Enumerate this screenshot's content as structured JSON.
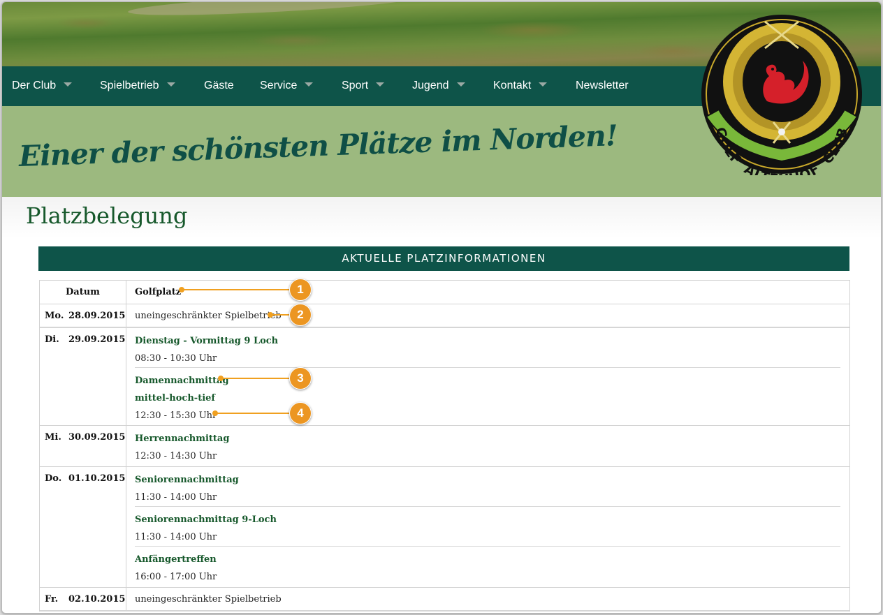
{
  "nav": {
    "items": [
      {
        "label": "Der Club",
        "dropdown": true
      },
      {
        "label": "Spielbetrieb",
        "dropdown": true
      },
      {
        "label": "Gäste",
        "dropdown": false
      },
      {
        "label": "Service",
        "dropdown": true
      },
      {
        "label": "Sport",
        "dropdown": true
      },
      {
        "label": "Jugend",
        "dropdown": true
      },
      {
        "label": "Kontakt",
        "dropdown": true
      },
      {
        "label": "Newsletter",
        "dropdown": false
      }
    ]
  },
  "banner": {
    "slogan": "Einer der schönsten Plätze im Norden!"
  },
  "logo": {
    "top_text": "GOLF",
    "ring_text": "ALTENHOF",
    "side_text": "CLUB",
    "icon": "squirrel-crest-icon"
  },
  "page": {
    "title": "Platzbelegung"
  },
  "table": {
    "header": "AKTUELLE PLATZINFORMATIONEN",
    "col_date": "Datum",
    "col_course": "Golfplatz",
    "rows": [
      {
        "dow": "Mo.",
        "date": "28.09.2015",
        "text": "uneingeschränkter Spielbetrieb"
      },
      {
        "dow": "Di.",
        "date": "29.09.2015",
        "events": [
          {
            "title": "Dienstag - Vormittag 9 Loch",
            "time": "08:30 - 10:30 Uhr"
          },
          {
            "title": "Damennachmittag",
            "subtitle": "mittel-hoch-tief",
            "time": "12:30 - 15:30 Uhr"
          }
        ]
      },
      {
        "dow": "Mi.",
        "date": "30.09.2015",
        "events": [
          {
            "title": "Herrennachmittag",
            "time": "12:30 - 14:30 Uhr"
          }
        ]
      },
      {
        "dow": "Do.",
        "date": "01.10.2015",
        "events": [
          {
            "title": "Seniorennachmittag",
            "time": "11:30 - 14:00 Uhr"
          },
          {
            "title": "Seniorennachmittag 9-Loch",
            "time": "11:30 - 14:00 Uhr"
          },
          {
            "title": "Anfängertreffen",
            "time": "16:00 - 17:00 Uhr"
          }
        ]
      },
      {
        "dow": "Fr.",
        "date": "02.10.2015",
        "text": "uneingeschränkter Spielbetrieb"
      }
    ]
  },
  "callouts": [
    "1",
    "2",
    "3",
    "4"
  ],
  "colors": {
    "nav_bg": "#0e5449",
    "banner_bg": "#9cb97f",
    "title_green": "#16582b",
    "callout_orange": "#ec9622"
  }
}
